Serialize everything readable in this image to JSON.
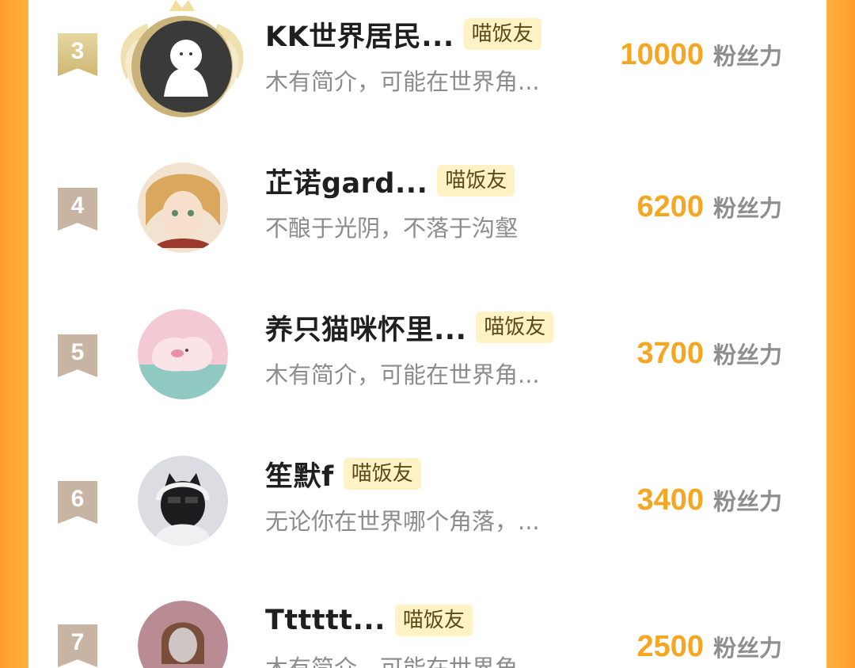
{
  "rows": [
    {
      "rank": "3",
      "name": "KK世界居民...",
      "badge": "喵饭友",
      "intro": "木有简介，可能在世界角...",
      "score": "10000",
      "unit": "粉丝力"
    },
    {
      "rank": "4",
      "name": "芷诺gard...",
      "badge": "喵饭友",
      "intro": "不酿于光阴，不落于沟壑",
      "score": "6200",
      "unit": "粉丝力"
    },
    {
      "rank": "5",
      "name": "养只猫咪怀里...",
      "badge": "喵饭友",
      "intro": "木有简介，可能在世界角...",
      "score": "3700",
      "unit": "粉丝力"
    },
    {
      "rank": "6",
      "name": "笙默f",
      "badge": "喵饭友",
      "intro": "无论你在世界哪个角落，...",
      "score": "3400",
      "unit": "粉丝力"
    },
    {
      "rank": "7",
      "name": "Tttttt...",
      "badge": "喵饭友",
      "intro": "木有简介，可能在世界角...",
      "score": "2500",
      "unit": "粉丝力"
    }
  ],
  "colors": {
    "accent": "#f5a623",
    "badge_bg": "#fff2c4",
    "frame": "#ffa233"
  }
}
